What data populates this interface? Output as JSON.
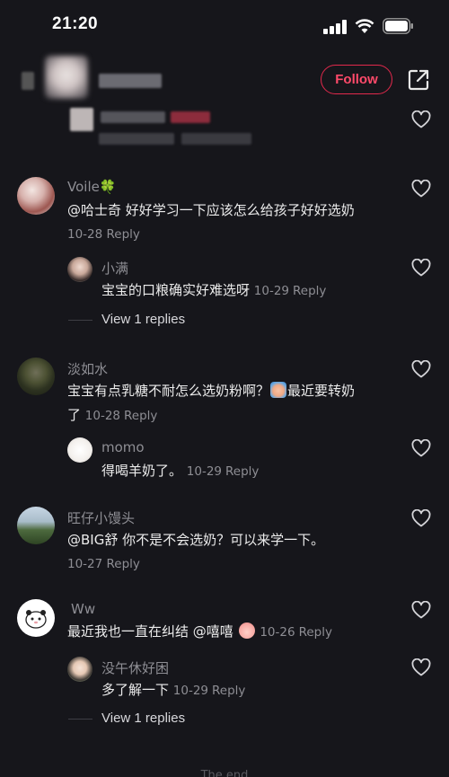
{
  "status_bar": {
    "time": "21:20"
  },
  "header": {
    "follow_label": "Follow"
  },
  "comments": [
    {
      "user": "Voile🍀",
      "text": "@哈士奇 好好学习一下应该怎么给孩子好好选奶",
      "date": "10-28",
      "reply_label": "Reply",
      "replies": [
        {
          "user": "小满",
          "text": "宝宝的口粮确实好难选呀",
          "date": "10-29",
          "reply_label": "Reply"
        }
      ],
      "view_replies": "View 1 replies"
    },
    {
      "user": "淡如水",
      "text_line1": "宝宝有点乳糖不耐怎么选奶粉啊？",
      "text_line1b": "最近要转奶",
      "text_line2": "了",
      "date": "10-28",
      "reply_label": "Reply",
      "replies": [
        {
          "user": "momo",
          "text": "得喝羊奶了。",
          "date": "10-29",
          "reply_label": "Reply"
        }
      ]
    },
    {
      "user": "旺仔小馒头",
      "text": "@BIG舒  你不是不会选奶？可以来学一下。",
      "date": "10-27",
      "reply_label": "Reply"
    },
    {
      "user": "Ww",
      "text": "最近我也一直在纠结 @嘻嘻",
      "date": "10-26",
      "reply_label": "Reply",
      "replies": [
        {
          "user": "没午休好困",
          "text": "多了解一下",
          "date": "10-29",
          "reply_label": "Reply"
        }
      ],
      "view_replies": "View 1 replies"
    }
  ],
  "footer": {
    "end_text": "The end"
  },
  "icons": {
    "heart": "heart-outline-icon",
    "share": "share-external-icon",
    "clover": "four-leaf-clover-emoji",
    "accent": "#e2294c"
  }
}
